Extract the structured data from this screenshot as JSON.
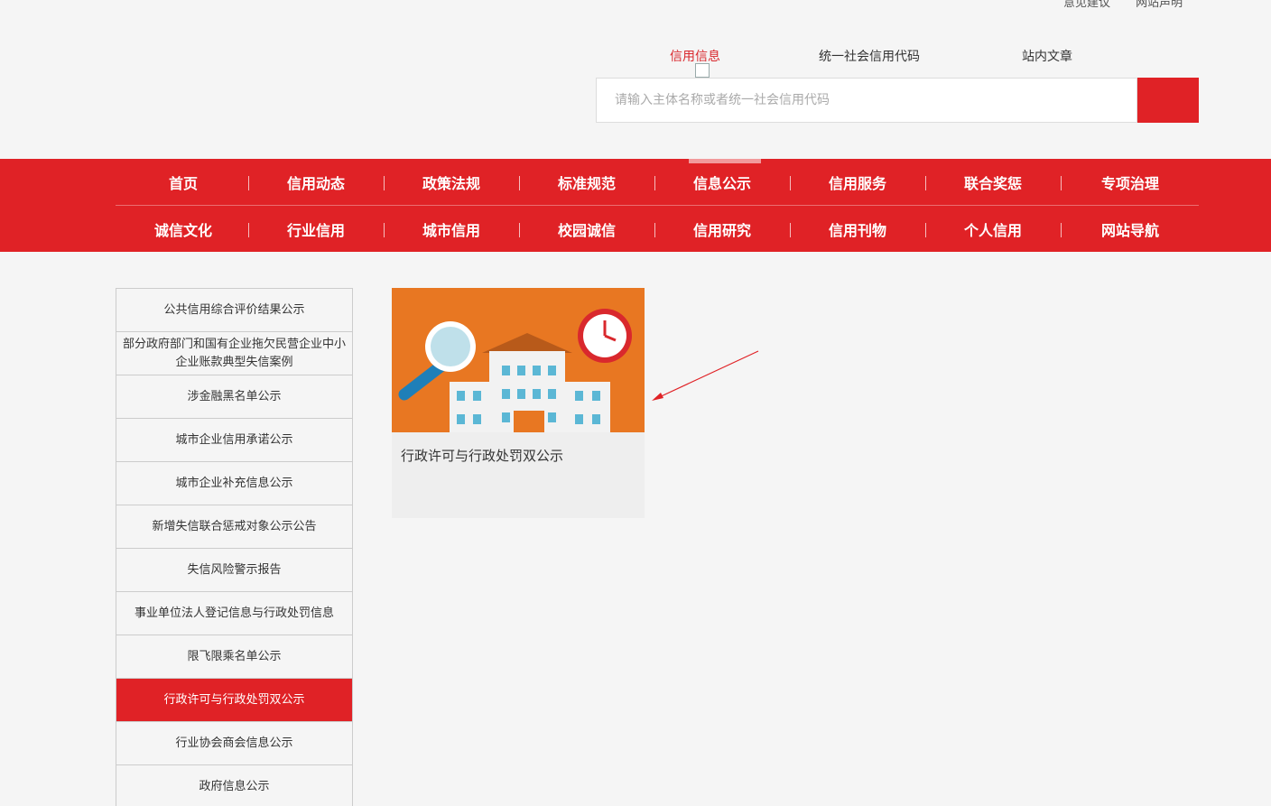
{
  "top_links": [
    "意见建议",
    "网站声明"
  ],
  "search": {
    "tabs": [
      "信用信息",
      "统一社会信用代码",
      "站内文章"
    ],
    "active_tab": "信用信息",
    "placeholder": "请输入主体名称或者统一社会信用代码"
  },
  "nav": {
    "row1": [
      "首页",
      "信用动态",
      "政策法规",
      "标准规范",
      "信息公示",
      "信用服务",
      "联合奖惩",
      "专项治理"
    ],
    "row2": [
      "诚信文化",
      "行业信用",
      "城市信用",
      "校园诚信",
      "信用研究",
      "信用刊物",
      "个人信用",
      "网站导航"
    ],
    "active": "信息公示"
  },
  "sidebar": {
    "items": [
      "公共信用综合评价结果公示",
      "部分政府部门和国有企业拖欠民营企业中小企业账款典型失信案例",
      "涉金融黑名单公示",
      "城市企业信用承诺公示",
      "城市企业补充信息公示",
      "新增失信联合惩戒对象公示公告",
      "失信风险警示报告",
      "事业单位法人登记信息与行政处罚信息",
      "限飞限乘名单公示",
      "行政许可与行政处罚双公示",
      "行业协会商会信息公示",
      "政府信息公示"
    ],
    "active_index": 9
  },
  "card": {
    "title": "行政许可与行政处罚双公示",
    "image_icon": "building-magnifier-clock-illustration"
  },
  "colors": {
    "brand_red": "#e02226",
    "card_orange": "#e87722"
  }
}
